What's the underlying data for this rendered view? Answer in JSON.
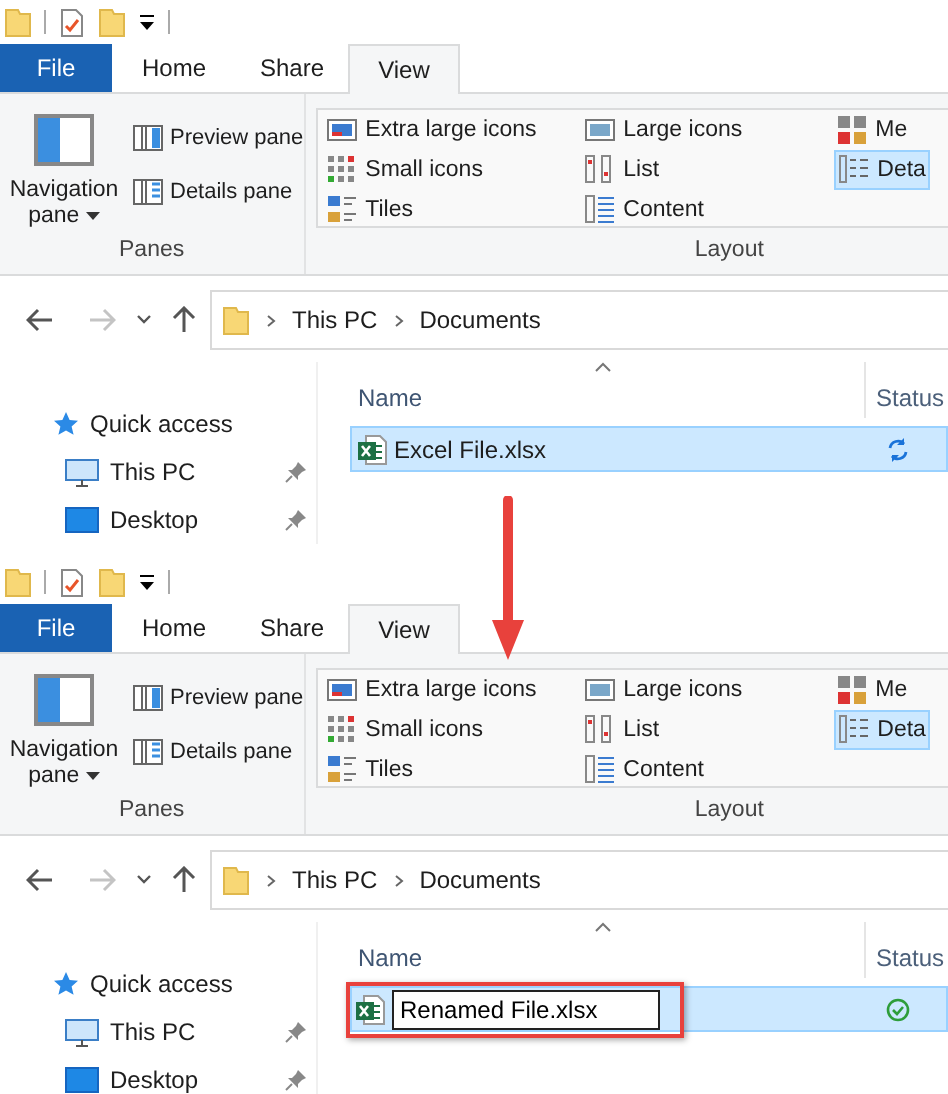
{
  "panels": [
    {
      "tabs": [
        {
          "label": "File",
          "kind": "file",
          "selected": false
        },
        {
          "label": "Home",
          "kind": "tab",
          "selected": false
        },
        {
          "label": "Share",
          "kind": "tab",
          "selected": false
        },
        {
          "label": "View",
          "kind": "tab",
          "selected": true
        }
      ],
      "ribbon": {
        "groups": [
          {
            "label": "Panes",
            "kind": "panes",
            "items": [
              {
                "label": "Navigation pane",
                "kind": "large"
              },
              {
                "label": "Preview pane",
                "kind": "small"
              },
              {
                "label": "Details pane",
                "kind": "small"
              }
            ]
          },
          {
            "label": "Layout",
            "kind": "layout",
            "items": [
              {
                "label": "Extra large icons",
                "selected": false
              },
              {
                "label": "Small icons",
                "selected": false
              },
              {
                "label": "Tiles",
                "selected": false
              },
              {
                "label": "Large icons",
                "selected": false
              },
              {
                "label": "List",
                "selected": false
              },
              {
                "label": "Content",
                "selected": false
              },
              {
                "label": "Me",
                "selected": false
              },
              {
                "label": "Deta",
                "selected": true
              }
            ]
          }
        ]
      },
      "nav_buttons": [
        {
          "kind": "back",
          "disabled": false
        },
        {
          "kind": "forward",
          "disabled": true
        },
        {
          "kind": "recent",
          "disabled": false
        },
        {
          "kind": "up",
          "disabled": false
        }
      ],
      "breadcrumbs": [
        "This PC",
        "Documents"
      ],
      "sidebar": [
        {
          "label": "Quick access",
          "kind": "quick",
          "pinned": false
        },
        {
          "label": "This PC",
          "kind": "pc",
          "pinned": true
        },
        {
          "label": "Desktop",
          "kind": "desktop",
          "pinned": true
        }
      ],
      "columns": [
        {
          "label": "Name",
          "sorted": true
        },
        {
          "label": "Status",
          "sorted": false
        }
      ],
      "files": [
        {
          "name": "Excel File.xlsx",
          "selected": true,
          "renaming": false,
          "highlighted": false,
          "synced": false
        }
      ]
    },
    {
      "tabs": [
        {
          "label": "File",
          "kind": "file",
          "selected": false
        },
        {
          "label": "Home",
          "kind": "tab",
          "selected": false
        },
        {
          "label": "Share",
          "kind": "tab",
          "selected": false
        },
        {
          "label": "View",
          "kind": "tab",
          "selected": true
        }
      ],
      "ribbon": {
        "groups": [
          {
            "label": "Panes",
            "kind": "panes",
            "items": [
              {
                "label": "Navigation pane",
                "kind": "large"
              },
              {
                "label": "Preview pane",
                "kind": "small"
              },
              {
                "label": "Details pane",
                "kind": "small"
              }
            ]
          },
          {
            "label": "Layout",
            "kind": "layout",
            "items": [
              {
                "label": "Extra large icons",
                "selected": false
              },
              {
                "label": "Small icons",
                "selected": false
              },
              {
                "label": "Tiles",
                "selected": false
              },
              {
                "label": "Large icons",
                "selected": false
              },
              {
                "label": "List",
                "selected": false
              },
              {
                "label": "Content",
                "selected": false
              },
              {
                "label": "Me",
                "selected": false
              },
              {
                "label": "Deta",
                "selected": true
              }
            ]
          }
        ]
      },
      "nav_buttons": [
        {
          "kind": "back",
          "disabled": false
        },
        {
          "kind": "forward",
          "disabled": true
        },
        {
          "kind": "recent",
          "disabled": false
        },
        {
          "kind": "up",
          "disabled": false
        }
      ],
      "breadcrumbs": [
        "This PC",
        "Documents"
      ],
      "sidebar": [
        {
          "label": "Quick access",
          "kind": "quick",
          "pinned": false
        },
        {
          "label": "This PC",
          "kind": "pc",
          "pinned": true
        },
        {
          "label": "Desktop",
          "kind": "desktop",
          "pinned": true
        }
      ],
      "columns": [
        {
          "label": "Name",
          "sorted": true
        },
        {
          "label": "Status",
          "sorted": false
        }
      ],
      "files": [
        {
          "name": "Renamed File.xlsx",
          "selected": true,
          "renaming": true,
          "highlighted": true,
          "synced": true
        }
      ]
    }
  ]
}
